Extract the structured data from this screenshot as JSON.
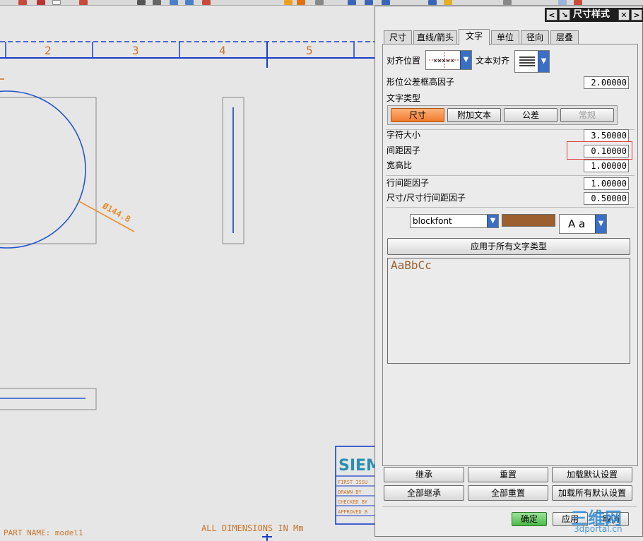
{
  "dialog": {
    "title": "尺寸样式",
    "tabs": [
      {
        "label": "尺寸"
      },
      {
        "label": "直线/箭头"
      },
      {
        "label": "文字"
      },
      {
        "label": "单位"
      },
      {
        "label": "径向"
      },
      {
        "label": "层叠"
      }
    ],
    "active_tab": "文字",
    "align_position_label": "对齐位置",
    "text_align_label": "文本对齐",
    "gdt_frame_height_label": "形位公差框高因子",
    "gdt_frame_height_value": "2.00000",
    "text_type_label": "文字类型",
    "text_types": [
      {
        "label": "尺寸"
      },
      {
        "label": "附加文本"
      },
      {
        "label": "公差"
      },
      {
        "label": "常规"
      }
    ],
    "char_size_label": "字符大小",
    "char_size_value": "3.50000",
    "spacing_factor_label": "间距因子",
    "spacing_factor_value": "0.10000",
    "aspect_ratio_label": "宽高比",
    "aspect_ratio_value": "1.00000",
    "line_spacing_label": "行间距因子",
    "line_spacing_value": "1.00000",
    "dim_line_spacing_label": "尺寸/尺寸行间距因子",
    "dim_line_spacing_value": "0.50000",
    "font_value": "blockfont",
    "text_color": "#9b5f30",
    "font_style_label": "A a",
    "apply_all_label": "应用于所有文字类型",
    "preview_text": "AaBbCc",
    "buttons": {
      "inherit": "继承",
      "reset": "重置",
      "load_default": "加载默认设置",
      "inherit_all": "全部继承",
      "reset_all": "全部重置",
      "load_all_default": "加载所有默认设置",
      "ok": "确定",
      "apply": "应用",
      "cancel": "取消"
    }
  },
  "drawing": {
    "zone_numbers": [
      {
        "label": "2"
      },
      {
        "label": "3"
      },
      {
        "label": "4"
      },
      {
        "label": "5"
      }
    ],
    "dimension_text": "Ø144.8",
    "part_name": "PART NAME: model1",
    "all_dims": "ALL DIMENSIONS IN Mm",
    "title_block": {
      "brand": "SIEM",
      "rows": [
        {
          "label": "FIRST ISSU"
        },
        {
          "label": "DRAWN BY"
        },
        {
          "label": "CHECKED BY"
        },
        {
          "label": "APPROVED B"
        }
      ]
    }
  },
  "watermark": {
    "main": "三维网",
    "sub": "3dportal.cn"
  }
}
